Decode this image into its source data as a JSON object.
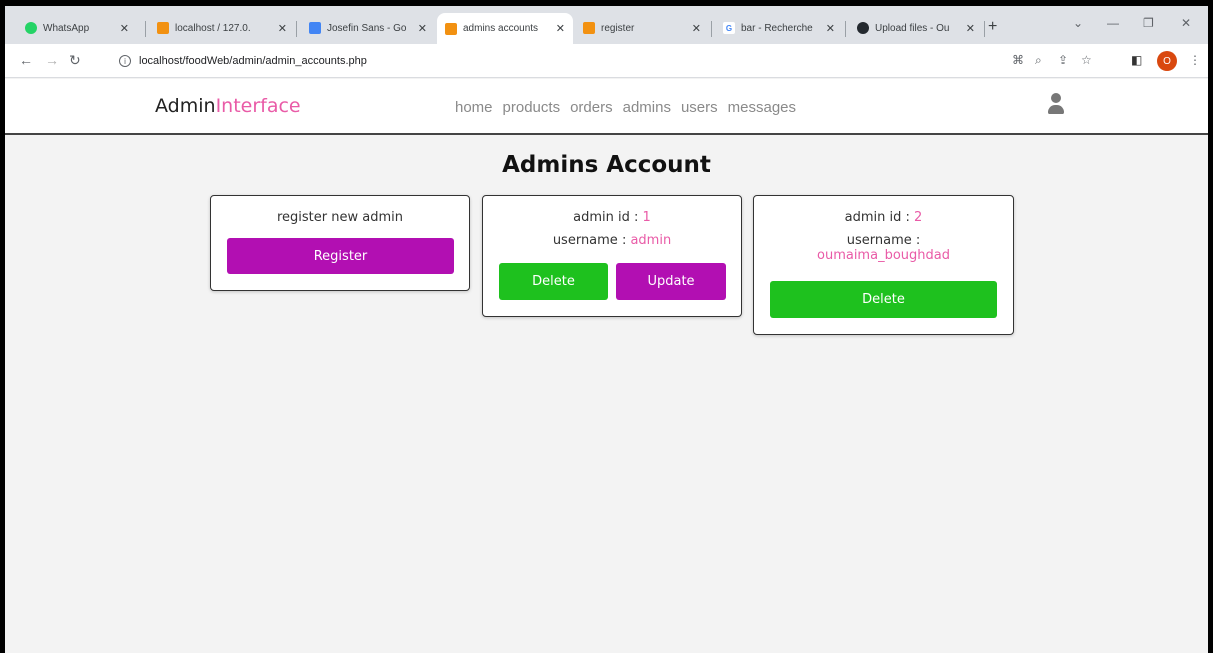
{
  "browser": {
    "tabs": [
      {
        "title": "WhatsApp",
        "fav_color": "#25d366"
      },
      {
        "title": "localhost / 127.0.",
        "fav_color": "#f29111"
      },
      {
        "title": "Josefin Sans - Go",
        "fav_color": "#4285f4"
      },
      {
        "title": "admins accounts",
        "fav_color": "#f29111",
        "active": true
      },
      {
        "title": "register",
        "fav_color": "#f29111"
      },
      {
        "title": "bar - Recherche",
        "fav_color": "#4285f4"
      },
      {
        "title": "Upload files - Ou",
        "fav_color": "#24292f"
      }
    ],
    "url": "localhost/foodWeb/admin/admin_accounts.php",
    "profile_initial": "O",
    "new_tab": "+"
  },
  "header": {
    "logo_main": "Admin",
    "logo_accent": "Interface",
    "nav": [
      "home",
      "products",
      "orders",
      "admins",
      "users",
      "messages"
    ]
  },
  "main": {
    "title": "Admins Account",
    "register_card": {
      "text": "register new admin",
      "button": "Register"
    },
    "admins": [
      {
        "id_label": "admin id : ",
        "id": "1",
        "username_label": "username : ",
        "username": "admin",
        "delete": "Delete",
        "update": "Update"
      },
      {
        "id_label": "admin id : ",
        "id": "2",
        "username_label": "username : ",
        "username": "oumaima_boughdad",
        "delete": "Delete"
      }
    ]
  },
  "colors": {
    "accent_pink": "#e95ba7",
    "purple": "#b20fb2",
    "green": "#1ec11e"
  }
}
